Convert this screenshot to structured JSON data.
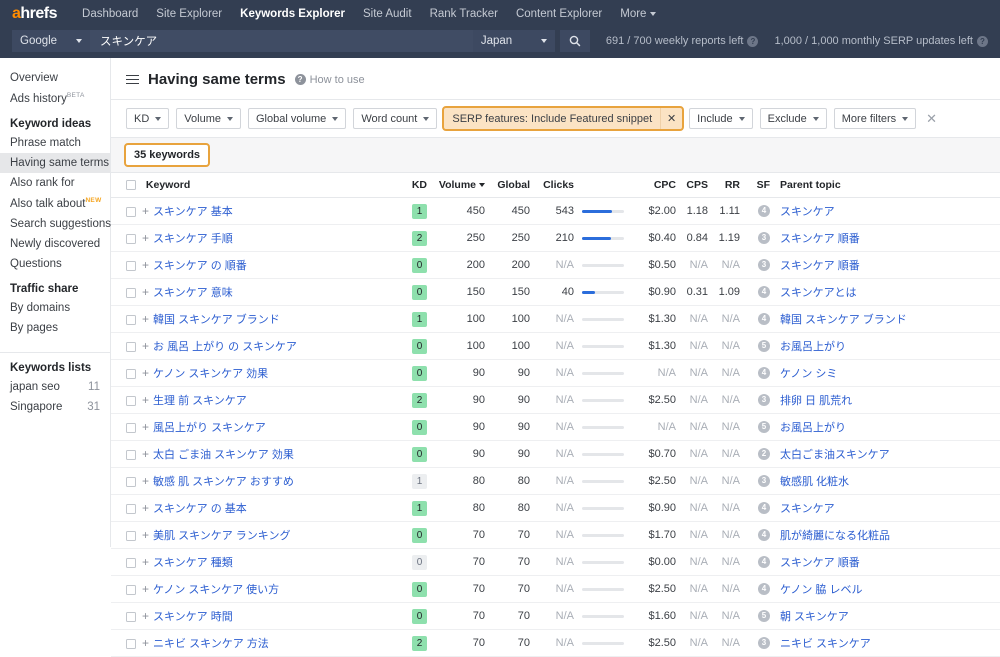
{
  "topnav": {
    "logo": "ahrefs",
    "links": [
      {
        "label": "Dashboard",
        "active": false
      },
      {
        "label": "Site Explorer",
        "active": false
      },
      {
        "label": "Keywords Explorer",
        "active": true
      },
      {
        "label": "Site Audit",
        "active": false
      },
      {
        "label": "Rank Tracker",
        "active": false
      },
      {
        "label": "Content Explorer",
        "active": false
      },
      {
        "label": "More",
        "active": false
      }
    ]
  },
  "search": {
    "engine": "Google",
    "query": "スキンケア",
    "placeholder": "スキンケア",
    "country": "Japan",
    "search_icon": "search-icon",
    "quota_reports": "691 / 700 weekly reports left",
    "quota_serp": "1,000 / 1,000 monthly SERP updates left"
  },
  "sidebar": {
    "top_items": [
      {
        "label": "Overview",
        "sup": "",
        "selected": false
      },
      {
        "label": "Ads history",
        "sup": "BETA",
        "selected": false
      }
    ],
    "keyword_ideas_heading": "Keyword ideas",
    "keyword_ideas": [
      {
        "label": "Phrase match",
        "sup": "",
        "selected": false
      },
      {
        "label": "Having same terms",
        "sup": "",
        "selected": true
      },
      {
        "label": "Also rank for",
        "sup": "",
        "selected": false
      },
      {
        "label": "Also talk about",
        "sup": "NEW",
        "selected": false
      },
      {
        "label": "Search suggestions",
        "sup": "",
        "selected": false
      },
      {
        "label": "Newly discovered",
        "sup": "",
        "selected": false
      },
      {
        "label": "Questions",
        "sup": "",
        "selected": false
      }
    ],
    "traffic_share_heading": "Traffic share",
    "traffic_share": [
      {
        "label": "By domains",
        "sup": "",
        "selected": false
      },
      {
        "label": "By pages",
        "sup": "",
        "selected": false
      }
    ],
    "keywords_lists_heading": "Keywords lists",
    "keywords_lists": [
      {
        "label": "japan seo",
        "count": "11"
      },
      {
        "label": "Singapore",
        "count": "31"
      }
    ]
  },
  "page": {
    "title": "Having same terms",
    "how_to_use": "How to use",
    "menu_icon": "hamburger-icon",
    "help_icon": "question-circle-icon"
  },
  "filters": {
    "buttons": [
      {
        "label": "KD"
      },
      {
        "label": "Volume"
      },
      {
        "label": "Global volume"
      },
      {
        "label": "Word count"
      }
    ],
    "active_filter": "SERP features: Include Featured snippet",
    "active_filter_remove": "✕",
    "right_buttons": [
      {
        "label": "Include"
      },
      {
        "label": "Exclude"
      },
      {
        "label": "More filters"
      }
    ],
    "clear_all": "✕",
    "highlight_color": "#e8a33d",
    "active_filter_bg": "#fbe3c4"
  },
  "results": {
    "count_label": "35 keywords",
    "columns": [
      "Keyword",
      "KD",
      "Volume",
      "Global",
      "Clicks",
      "",
      "CPC",
      "CPS",
      "RR",
      "SF",
      "Parent topic"
    ],
    "sorted_column": "Volume",
    "rows": [
      {
        "keyword": "スキンケア 基本",
        "kd": "1",
        "kd_gray": false,
        "volume": "450",
        "global": "450",
        "clicks": "543",
        "bar": 72,
        "cpc": "$2.00",
        "cps": "1.18",
        "rr": "1.11",
        "sf": "4",
        "parent": "スキンケア"
      },
      {
        "keyword": "スキンケア 手順",
        "kd": "2",
        "kd_gray": false,
        "volume": "250",
        "global": "250",
        "clicks": "210",
        "bar": 68,
        "cpc": "$0.40",
        "cps": "0.84",
        "rr": "1.19",
        "sf": "3",
        "parent": "スキンケア 順番"
      },
      {
        "keyword": "スキンケア の 順番",
        "kd": "0",
        "kd_gray": false,
        "volume": "200",
        "global": "200",
        "clicks": "N/A",
        "bar": 0,
        "cpc": "$0.50",
        "cps": "N/A",
        "rr": "N/A",
        "sf": "3",
        "parent": "スキンケア 順番"
      },
      {
        "keyword": "スキンケア 意味",
        "kd": "0",
        "kd_gray": false,
        "volume": "150",
        "global": "150",
        "clicks": "40",
        "bar": 30,
        "cpc": "$0.90",
        "cps": "0.31",
        "rr": "1.09",
        "sf": "4",
        "parent": "スキンケアとは"
      },
      {
        "keyword": "韓国 スキンケア ブランド",
        "kd": "1",
        "kd_gray": false,
        "volume": "100",
        "global": "100",
        "clicks": "N/A",
        "bar": 0,
        "cpc": "$1.30",
        "cps": "N/A",
        "rr": "N/A",
        "sf": "4",
        "parent": "韓国 スキンケア ブランド"
      },
      {
        "keyword": "お 風呂 上がり の スキンケア",
        "kd": "0",
        "kd_gray": false,
        "volume": "100",
        "global": "100",
        "clicks": "N/A",
        "bar": 0,
        "cpc": "$1.30",
        "cps": "N/A",
        "rr": "N/A",
        "sf": "5",
        "parent": "お風呂上がり"
      },
      {
        "keyword": "ケノン スキンケア 効果",
        "kd": "0",
        "kd_gray": false,
        "volume": "90",
        "global": "90",
        "clicks": "N/A",
        "bar": 0,
        "cpc": "N/A",
        "cps": "N/A",
        "rr": "N/A",
        "sf": "4",
        "parent": "ケノン シミ"
      },
      {
        "keyword": "生理 前 スキンケア",
        "kd": "2",
        "kd_gray": false,
        "volume": "90",
        "global": "90",
        "clicks": "N/A",
        "bar": 0,
        "cpc": "$2.50",
        "cps": "N/A",
        "rr": "N/A",
        "sf": "3",
        "parent": "排卵 日 肌荒れ"
      },
      {
        "keyword": "風呂上がり スキンケア",
        "kd": "0",
        "kd_gray": false,
        "volume": "90",
        "global": "90",
        "clicks": "N/A",
        "bar": 0,
        "cpc": "N/A",
        "cps": "N/A",
        "rr": "N/A",
        "sf": "5",
        "parent": "お風呂上がり"
      },
      {
        "keyword": "太白 ごま油 スキンケア 効果",
        "kd": "0",
        "kd_gray": false,
        "volume": "90",
        "global": "90",
        "clicks": "N/A",
        "bar": 0,
        "cpc": "$0.70",
        "cps": "N/A",
        "rr": "N/A",
        "sf": "2",
        "parent": "太白ごま油スキンケア"
      },
      {
        "keyword": "敏感 肌 スキンケア おすすめ",
        "kd": "1",
        "kd_gray": true,
        "volume": "80",
        "global": "80",
        "clicks": "N/A",
        "bar": 0,
        "cpc": "$2.50",
        "cps": "N/A",
        "rr": "N/A",
        "sf": "3",
        "parent": "敏感肌 化粧水"
      },
      {
        "keyword": "スキンケア の 基本",
        "kd": "1",
        "kd_gray": false,
        "volume": "80",
        "global": "80",
        "clicks": "N/A",
        "bar": 0,
        "cpc": "$0.90",
        "cps": "N/A",
        "rr": "N/A",
        "sf": "4",
        "parent": "スキンケア"
      },
      {
        "keyword": "美肌 スキンケア ランキング",
        "kd": "0",
        "kd_gray": false,
        "volume": "70",
        "global": "70",
        "clicks": "N/A",
        "bar": 0,
        "cpc": "$1.70",
        "cps": "N/A",
        "rr": "N/A",
        "sf": "4",
        "parent": "肌が綺麗になる化粧品"
      },
      {
        "keyword": "スキンケア 種類",
        "kd": "0",
        "kd_gray": true,
        "volume": "70",
        "global": "70",
        "clicks": "N/A",
        "bar": 0,
        "cpc": "$0.00",
        "cps": "N/A",
        "rr": "N/A",
        "sf": "4",
        "parent": "スキンケア 順番"
      },
      {
        "keyword": "ケノン スキンケア 使い方",
        "kd": "0",
        "kd_gray": false,
        "volume": "70",
        "global": "70",
        "clicks": "N/A",
        "bar": 0,
        "cpc": "$2.50",
        "cps": "N/A",
        "rr": "N/A",
        "sf": "4",
        "parent": "ケノン 脇 レベル"
      },
      {
        "keyword": "スキンケア 時間",
        "kd": "0",
        "kd_gray": false,
        "volume": "70",
        "global": "70",
        "clicks": "N/A",
        "bar": 0,
        "cpc": "$1.60",
        "cps": "N/A",
        "rr": "N/A",
        "sf": "5",
        "parent": "朝 スキンケア"
      },
      {
        "keyword": "ニキビ スキンケア 方法",
        "kd": "2",
        "kd_gray": false,
        "volume": "70",
        "global": "70",
        "clicks": "N/A",
        "bar": 0,
        "cpc": "$2.50",
        "cps": "N/A",
        "rr": "N/A",
        "sf": "3",
        "parent": "ニキビ スキンケア"
      }
    ]
  }
}
